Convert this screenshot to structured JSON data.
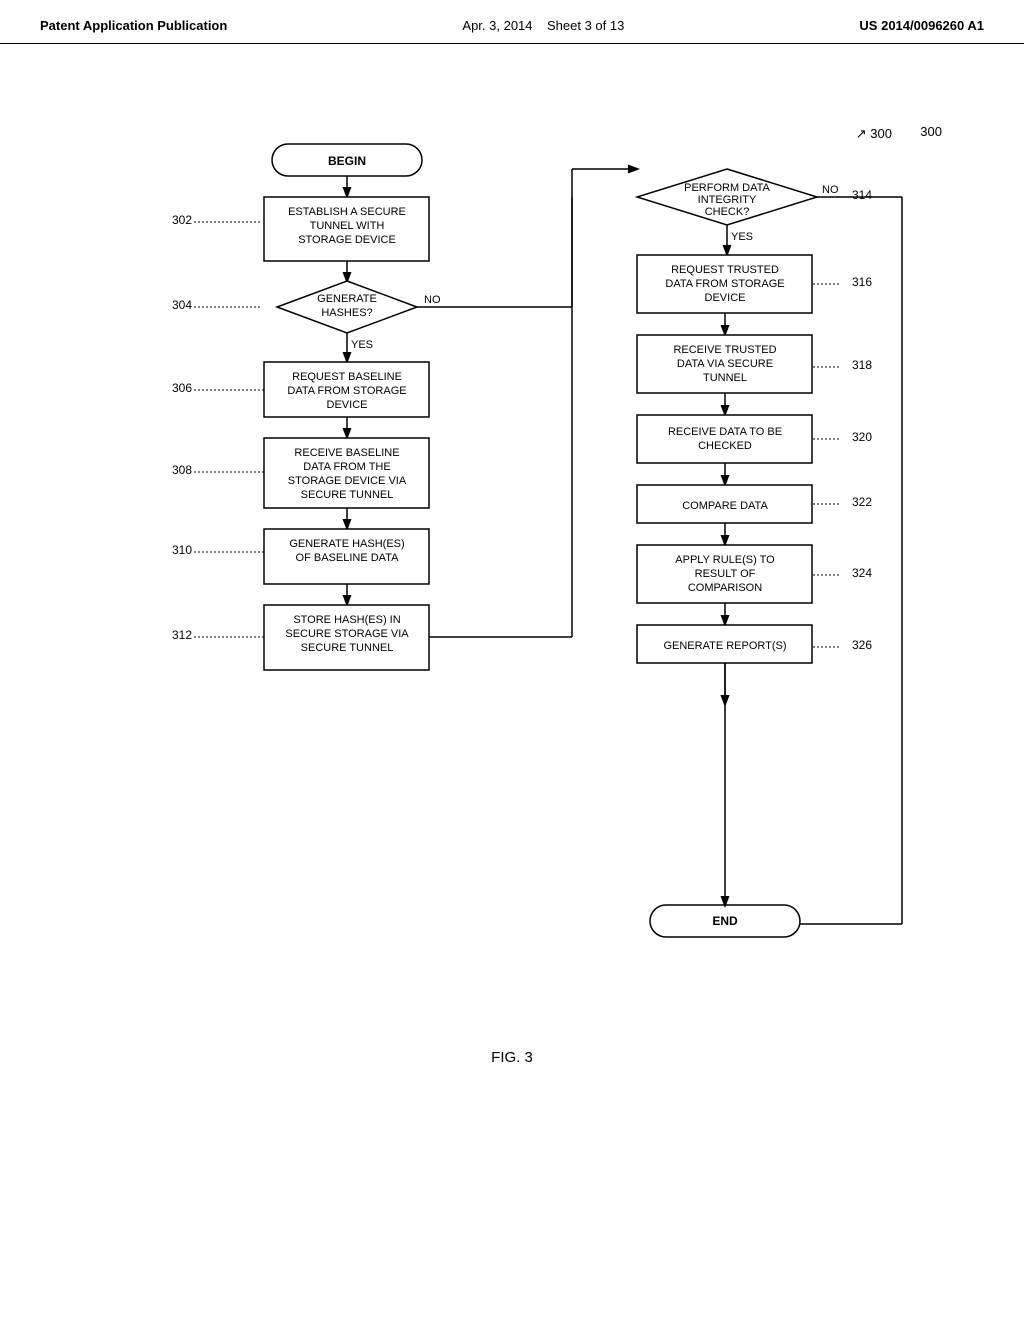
{
  "header": {
    "left": "Patent Application Publication",
    "center_date": "Apr. 3, 2014",
    "center_sheet": "Sheet 3 of 13",
    "right": "US 2014/0096260 A1"
  },
  "fig_label": "FIG. 3",
  "flowchart": {
    "ref_main": "300",
    "nodes": {
      "begin": "BEGIN",
      "n302_label": "302",
      "n302": "ESTABLISH A SECURE\nTUNNEL WITH\nSTORAGE DEVICE",
      "n304_label": "304",
      "n304": "GENERATE\nHASHES?",
      "n304_no": "NO",
      "n304_yes": "YES",
      "n306_label": "306",
      "n306": "REQUEST BASELINE\nDATA FROM STORAGE\nDEVICE",
      "n308_label": "308",
      "n308": "RECEIVE BASELINE\nDATA FROM THE\nSTORAGE DEVICE VIA\nSECURE TUNNEL",
      "n310_label": "310",
      "n310": "GENERATE HASH(ES)\nOF BASELINE DATA",
      "n312_label": "312",
      "n312": "STORE HASH(ES) IN\nSECURE STORAGE VIA\nSECURE TUNNEL",
      "n314_label": "314",
      "n314": "PERFORM DATA\nINTEGRITY\nCHECK?",
      "n314_no": "NO",
      "n314_yes": "YES",
      "n316_label": "316",
      "n316": "REQUEST TRUSTED\nDATA FROM STORAGE\nDEVICE",
      "n318_label": "318",
      "n318": "RECEIVE TRUSTED\nDATA VIA SECURE\nTUNNEL",
      "n320_label": "320",
      "n320": "RECEIVE DATA TO BE\nCHECKED",
      "n322_label": "322",
      "n322": "COMPARE DATA",
      "n324_label": "324",
      "n324": "APPLY RULE(S) TO\nRESULT OF\nCOMPARISON",
      "n326_label": "326",
      "n326": "GENERATE REPORT(S)",
      "end": "END"
    }
  }
}
